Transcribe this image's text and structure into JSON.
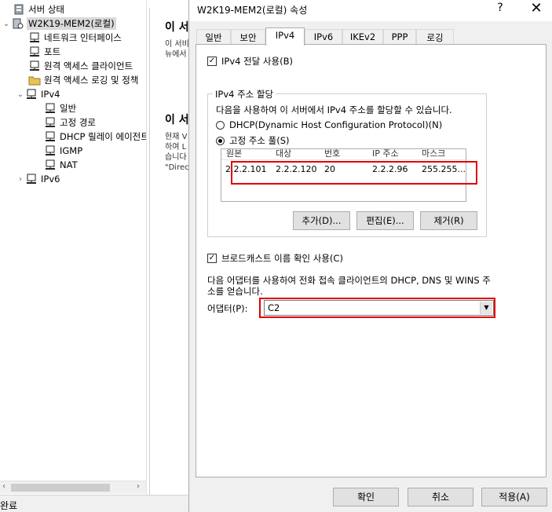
{
  "tree": {
    "items": [
      {
        "label": "서버 상태",
        "icon": "server-status-icon"
      },
      {
        "label": "W2K19-MEM2(로컬)",
        "icon": "server-icon",
        "expander": "⌄",
        "selected": true
      },
      {
        "label": "네트워크 인터페이스",
        "icon": "network-node-icon"
      },
      {
        "label": "포트",
        "icon": "network-node-icon"
      },
      {
        "label": "원격 액세스 클라이언트",
        "icon": "network-node-icon"
      },
      {
        "label": "원격 액세스 로깅 및 정책",
        "icon": "folder-icon"
      },
      {
        "label": "IPv4",
        "icon": "network-node-icon",
        "expander": "⌄"
      },
      {
        "label": "일반",
        "icon": "network-node-icon"
      },
      {
        "label": "고정 경로",
        "icon": "network-node-icon"
      },
      {
        "label": "DHCP 릴레이 에이전트",
        "icon": "network-node-icon"
      },
      {
        "label": "IGMP",
        "icon": "network-node-icon"
      },
      {
        "label": "NAT",
        "icon": "network-node-icon"
      },
      {
        "label": "IPv6",
        "icon": "network-node-icon",
        "expander": "›"
      }
    ]
  },
  "content": {
    "heading1": "이 서",
    "line1": "이 서비",
    "line2": "뉴에서",
    "heading2": "이 서",
    "para": [
      "현재 V",
      "하여 L",
      "습니다",
      "\"Direct"
    ]
  },
  "status": {
    "text": "완료"
  },
  "dialog": {
    "title": "W2K19-MEM2(로컬) 속성",
    "help": "?",
    "close": "✕",
    "tabs": [
      "일반",
      "보안",
      "IPv4",
      "IPv6",
      "IKEv2",
      "PPP",
      "로깅"
    ],
    "active_tab": "IPv4",
    "ipv4_forwarding": {
      "label": "IPv4 전달 사용(B)",
      "checked": true
    },
    "group": {
      "legend": "IPv4 주소 할당",
      "description": "다음을 사용하여 이 서버에서 IPv4 주소를 할당할 수 있습니다.",
      "dhcp_option": "DHCP(Dynamic Host Configuration Protocol)(N)",
      "static_option": "고정 주소 풀(S)",
      "selected": "static",
      "columns": [
        "원본",
        "대상",
        "번호",
        "IP 주소",
        "마스크"
      ],
      "rows": [
        [
          "2.2.2.101",
          "2.2.2.120",
          "20",
          "2.2.2.96",
          "255.255...."
        ]
      ],
      "buttons": {
        "add": "추가(D)...",
        "edit": "편집(E)...",
        "remove": "제거(R)"
      }
    },
    "broadcast": {
      "label": "브로드캐스트 이름 확인 사용(C)",
      "checked": true
    },
    "adapter_desc_1": "다음 어댑터를 사용하여 전화 접속 클라이언트의 DHCP, DNS 및 WINS 주",
    "adapter_desc_2": "소를 얻습니다.",
    "adapter_label": "어댑터(P):",
    "adapter_value": "C2",
    "footer": {
      "ok": "확인",
      "cancel": "취소",
      "apply": "적용(A)"
    }
  },
  "colors": {
    "highlight": "#e00000",
    "accent": "#0078d7"
  }
}
